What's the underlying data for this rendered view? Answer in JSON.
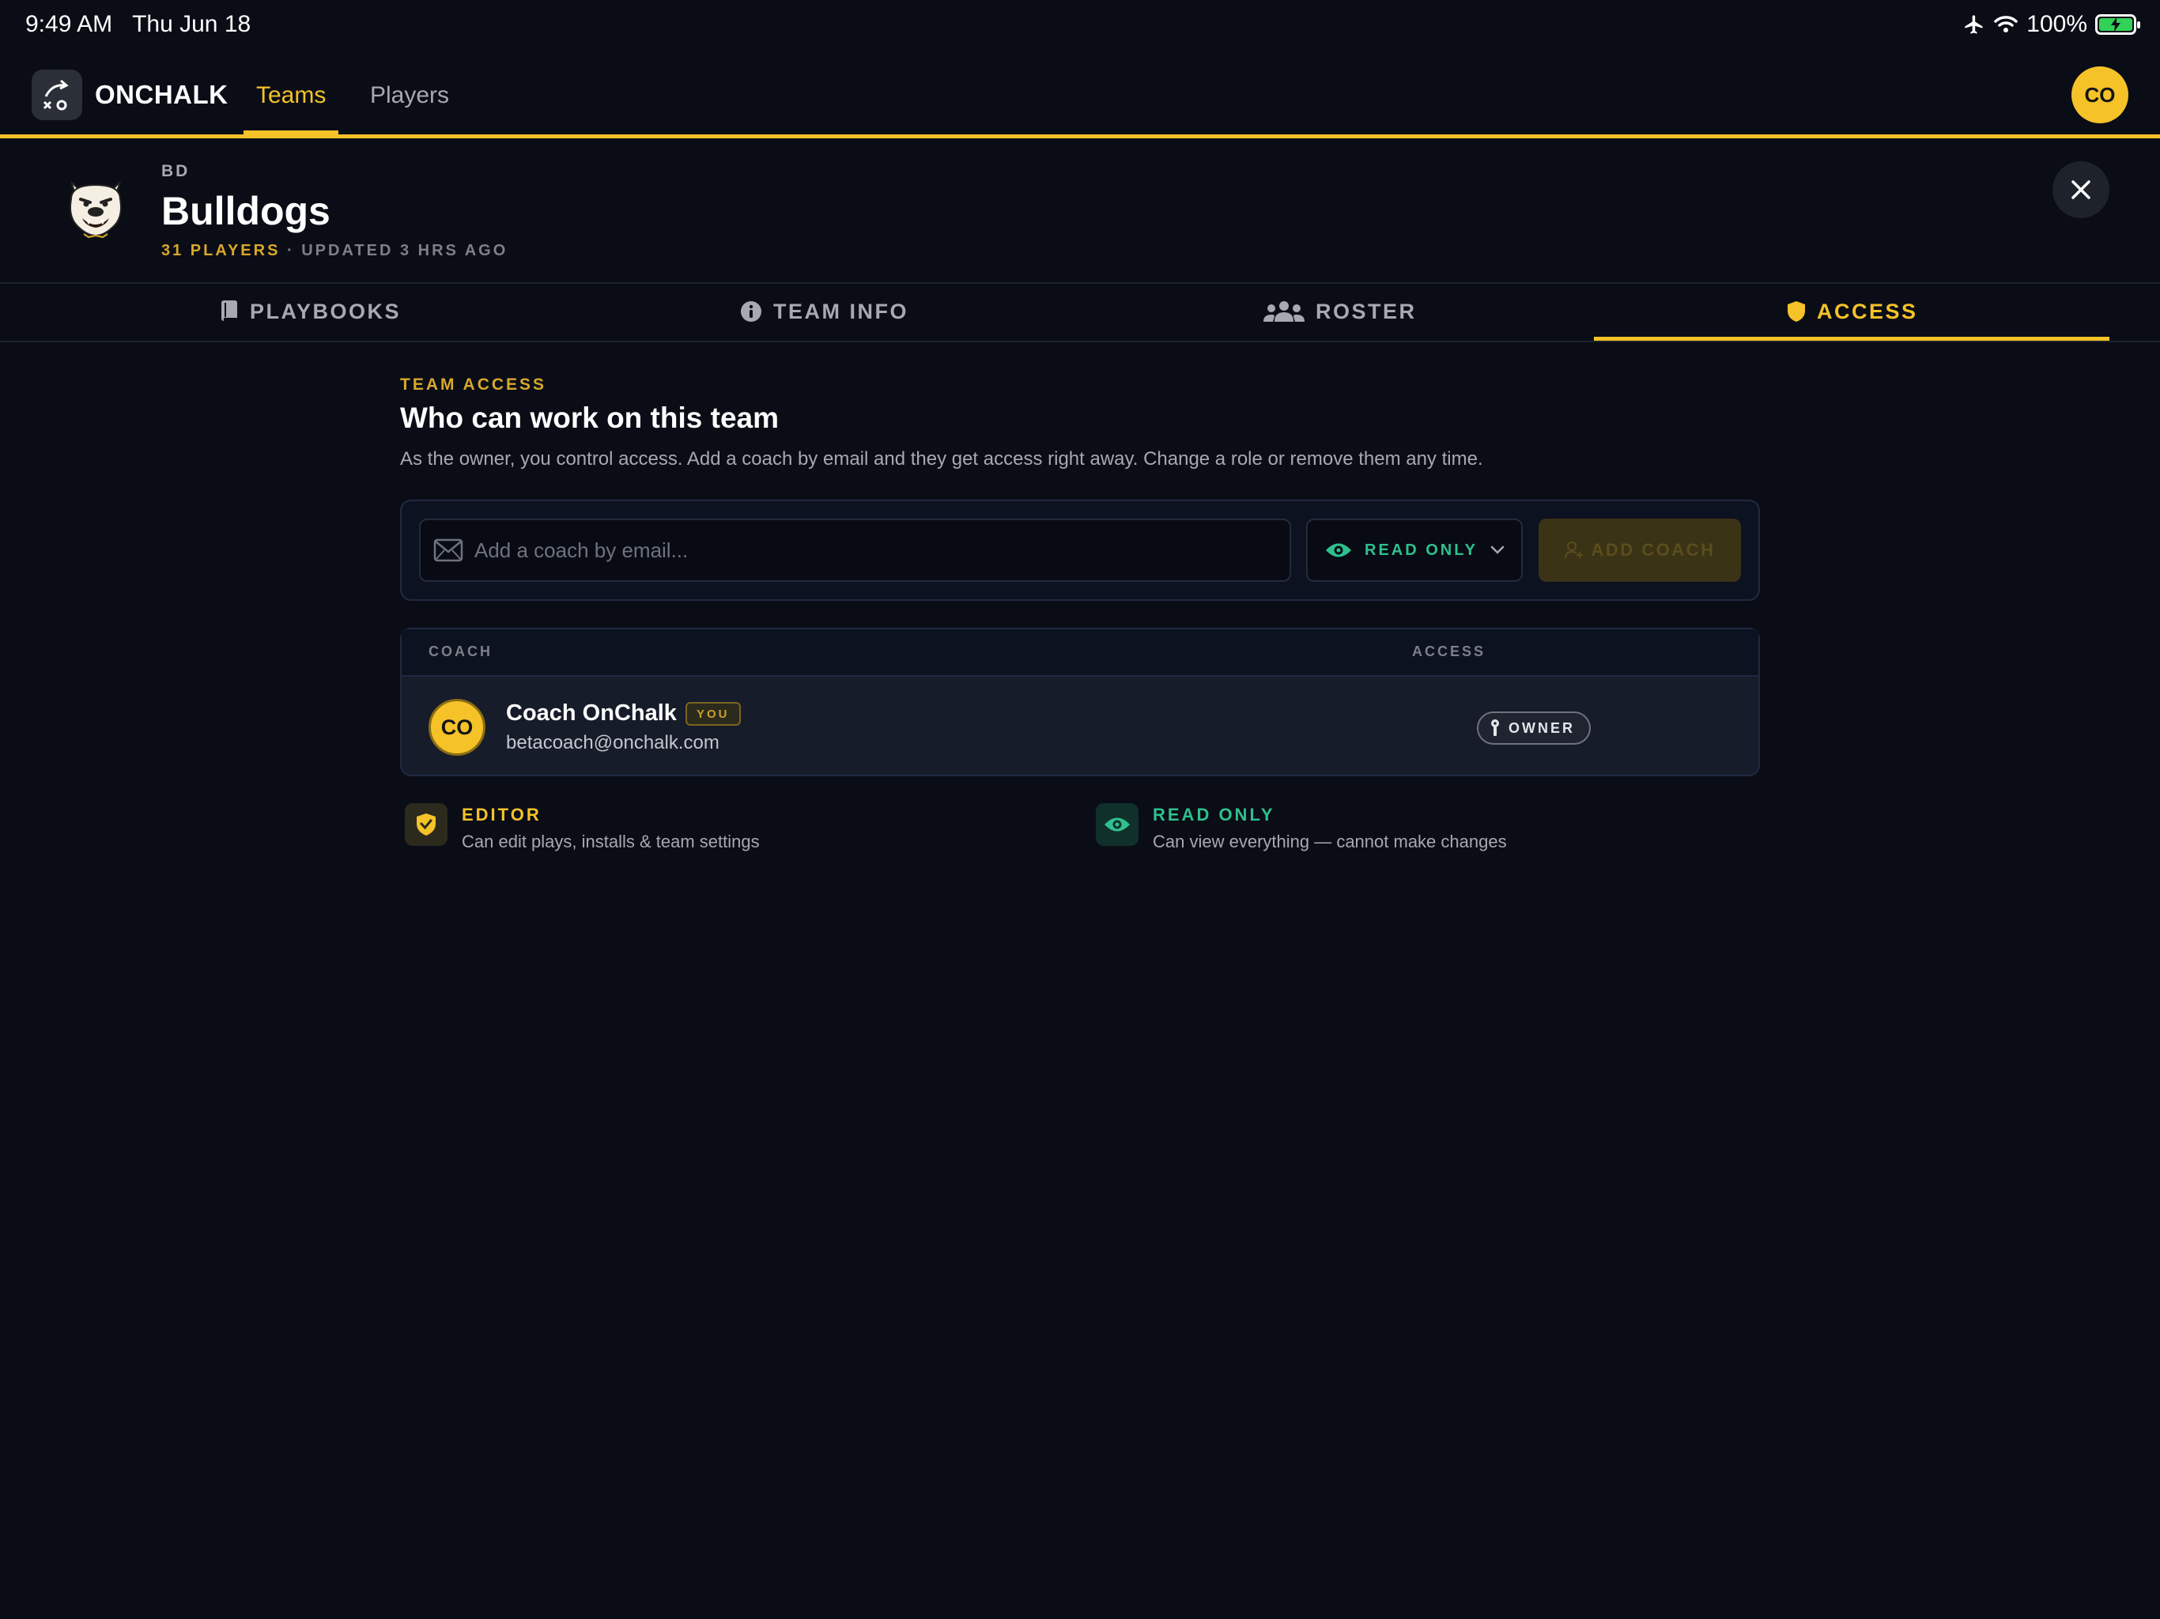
{
  "status_bar": {
    "time": "9:49 AM",
    "date": "Thu Jun 18",
    "battery": "100%"
  },
  "nav": {
    "brand": "ONCHALK",
    "tabs": [
      {
        "label": "Teams",
        "active": true
      },
      {
        "label": "Players",
        "active": false
      }
    ],
    "user_initials": "CO"
  },
  "team": {
    "abbr": "BD",
    "name": "Bulldogs",
    "players": "31 PLAYERS",
    "separator": "·",
    "updated": "UPDATED 3 HRS AGO"
  },
  "section_tabs": [
    {
      "label": "PLAYBOOKS",
      "icon": "book-icon"
    },
    {
      "label": "TEAM INFO",
      "icon": "info-icon"
    },
    {
      "label": "ROSTER",
      "icon": "users-icon"
    },
    {
      "label": "ACCESS",
      "icon": "shield-icon",
      "active": true
    }
  ],
  "access": {
    "kicker": "TEAM ACCESS",
    "heading": "Who can work on this team",
    "description": "As the owner, you control access. Add a coach by email and they get access right away. Change a role or remove them any time.",
    "invite": {
      "email_placeholder": "Add a coach by email...",
      "email_value": "",
      "role": "READ ONLY",
      "add_button": "ADD COACH",
      "add_disabled": true
    },
    "table": {
      "columns": [
        "COACH",
        "ACCESS"
      ],
      "rows": [
        {
          "initials": "CO",
          "name": "Coach OnChalk",
          "badge": "YOU",
          "email": "betacoach@onchalk.com",
          "role": "OWNER"
        }
      ]
    },
    "legend": [
      {
        "title": "EDITOR",
        "description": "Can edit plays, installs & team settings"
      },
      {
        "title": "READ ONLY",
        "description": "Can view everything — cannot make changes"
      }
    ]
  },
  "colors": {
    "background": "#0a0d16",
    "accent": "#f5c228",
    "read_only": "#2fc08d"
  }
}
